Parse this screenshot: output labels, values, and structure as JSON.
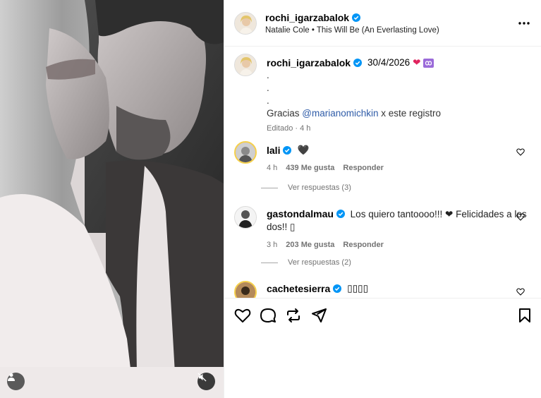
{
  "post": {
    "author": "rochi_igarzabalok",
    "song": "Natalie Cole • This Will Be (An Everlasting Love)"
  },
  "caption": {
    "author": "rochi_igarzabalok",
    "date_text": "30/4/2026",
    "emoji_heart": "❤",
    "dots": [
      ".",
      ".",
      "."
    ],
    "thanks_prefix": "Gracias ",
    "mention": "@marianomichkin",
    "thanks_suffix": " x este registro",
    "edited": "Editado · 4 h"
  },
  "comments": [
    {
      "user": "lali",
      "text": "🖤",
      "time": "4 h",
      "likes": "439 Me gusta",
      "reply": "Responder",
      "view_replies": "Ver respuestas (3)"
    },
    {
      "user": "gastondalmau",
      "text": "Los quiero tantoooo!!! ❤ Felicidades a los dos!! ▯",
      "time": "3 h",
      "likes": "203 Me gusta",
      "reply": "Responder",
      "view_replies": "Ver respuestas (2)"
    },
    {
      "user": "cachetesierra",
      "text": "▯▯▯▯"
    }
  ],
  "colors": {
    "verified": "#0095f6",
    "heart": "#e0245e",
    "mention": "#2f5ca8"
  }
}
